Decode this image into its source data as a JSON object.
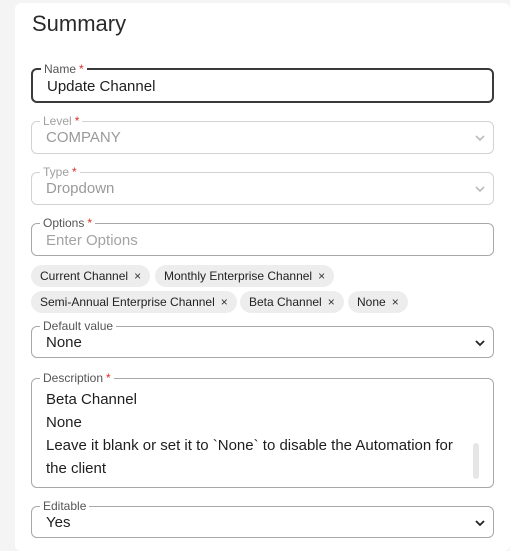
{
  "section": {
    "title": "Summary"
  },
  "fields": {
    "name": {
      "label": "Name",
      "required_mark": "*",
      "value": "Update Channel"
    },
    "level": {
      "label": "Level",
      "required_mark": "*",
      "value": "COMPANY"
    },
    "type": {
      "label": "Type",
      "required_mark": "*",
      "value": "Dropdown"
    },
    "options": {
      "label": "Options",
      "required_mark": "*",
      "placeholder": "Enter Options"
    },
    "default_value": {
      "label": "Default value",
      "value": "None"
    },
    "description": {
      "label": "Description",
      "required_mark": "*",
      "lines": [
        "Beta Channel",
        "None",
        "Leave it blank or set it to `None` to disable the Automation for",
        "the client"
      ]
    },
    "editable": {
      "label": "Editable",
      "value": "Yes"
    }
  },
  "option_chips": [
    {
      "label": "Current Channel",
      "remove": "×"
    },
    {
      "label": "Monthly Enterprise Channel",
      "remove": "×"
    },
    {
      "label": "Semi-Annual Enterprise Channel",
      "remove": "×"
    },
    {
      "label": "Beta Channel",
      "remove": "×"
    },
    {
      "label": "None",
      "remove": "×"
    }
  ],
  "icons": {
    "dropdown": "chevron-down-icon",
    "remove_chip": "close-icon"
  }
}
